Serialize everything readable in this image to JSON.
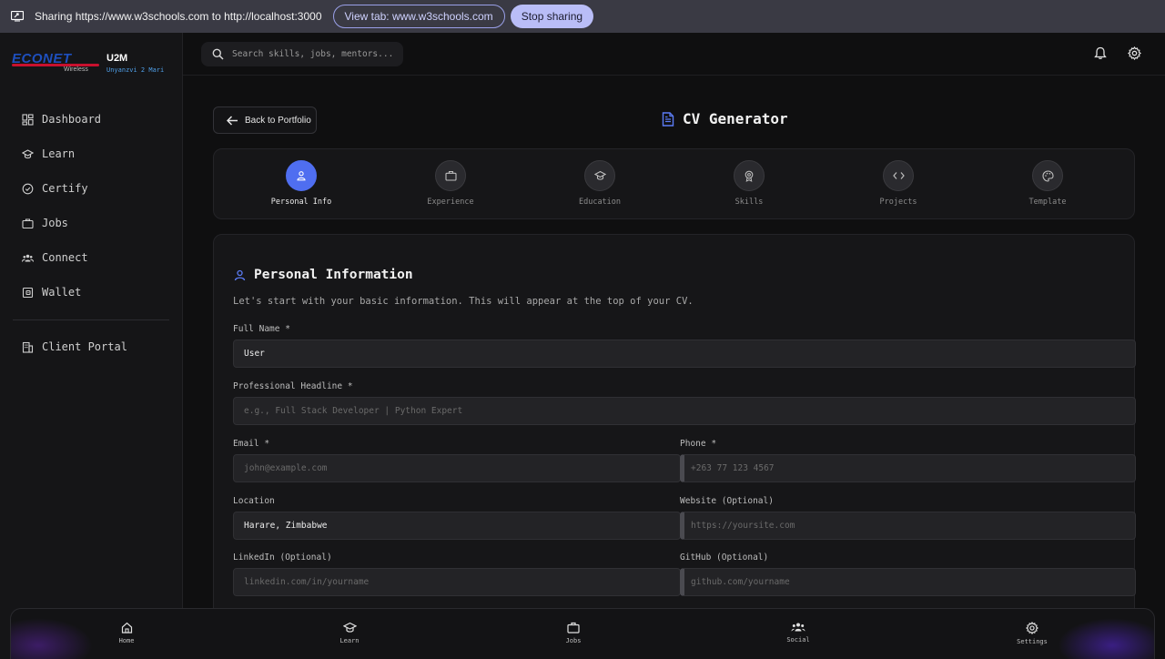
{
  "sharebar": {
    "text": "Sharing https://www.w3schools.com to http://localhost:3000",
    "view_tab": "View tab: www.w3schools.com",
    "stop": "Stop sharing"
  },
  "brand": {
    "econet": "ECONET",
    "wireless": "Wireless",
    "app": "U2M",
    "tagline": "Unyanzvi 2 Mari"
  },
  "sidebar": {
    "items": [
      {
        "label": "Dashboard",
        "icon": "dashboard-icon"
      },
      {
        "label": "Learn",
        "icon": "graduation-cap-icon"
      },
      {
        "label": "Certify",
        "icon": "badge-check-icon"
      },
      {
        "label": "Jobs",
        "icon": "briefcase-icon"
      },
      {
        "label": "Connect",
        "icon": "users-icon"
      },
      {
        "label": "Wallet",
        "icon": "wallet-icon"
      }
    ],
    "client_portal": "Client Portal"
  },
  "topbar": {
    "search_placeholder": "Search skills, jobs, mentors..."
  },
  "page": {
    "back": "Back to Portfolio",
    "title": "CV Generator"
  },
  "steps": [
    {
      "label": "Personal Info",
      "active": true
    },
    {
      "label": "Experience"
    },
    {
      "label": "Education"
    },
    {
      "label": "Skills"
    },
    {
      "label": "Projects"
    },
    {
      "label": "Template"
    }
  ],
  "form": {
    "heading": "Personal Information",
    "description": "Let's start with your basic information. This will appear at the top of your CV.",
    "full_name": {
      "label": "Full Name *",
      "value": "User"
    },
    "headline": {
      "label": "Professional Headline *",
      "placeholder": "e.g., Full Stack Developer | Python Expert"
    },
    "email": {
      "label": "Email *",
      "placeholder": "john@example.com"
    },
    "phone": {
      "label": "Phone *",
      "placeholder": "+263 77 123 4567"
    },
    "location": {
      "label": "Location",
      "value": "Harare, Zimbabwe"
    },
    "website": {
      "label": "Website (Optional)",
      "placeholder": "https://yoursite.com"
    },
    "linkedin": {
      "label": "LinkedIn (Optional)",
      "placeholder": "linkedin.com/in/yourname"
    },
    "github": {
      "label": "GitHub (Optional)",
      "placeholder": "github.com/yourname"
    }
  },
  "bottomnav": [
    {
      "label": "Home",
      "icon": "home-icon"
    },
    {
      "label": "Learn",
      "icon": "graduation-cap-icon"
    },
    {
      "label": "Jobs",
      "icon": "briefcase-icon"
    },
    {
      "label": "Social",
      "icon": "users-icon"
    },
    {
      "label": "Settings",
      "icon": "gear-icon"
    }
  ],
  "colors": {
    "accent": "#4f6ef0",
    "background": "#0f0f10",
    "panel": "#161618"
  }
}
